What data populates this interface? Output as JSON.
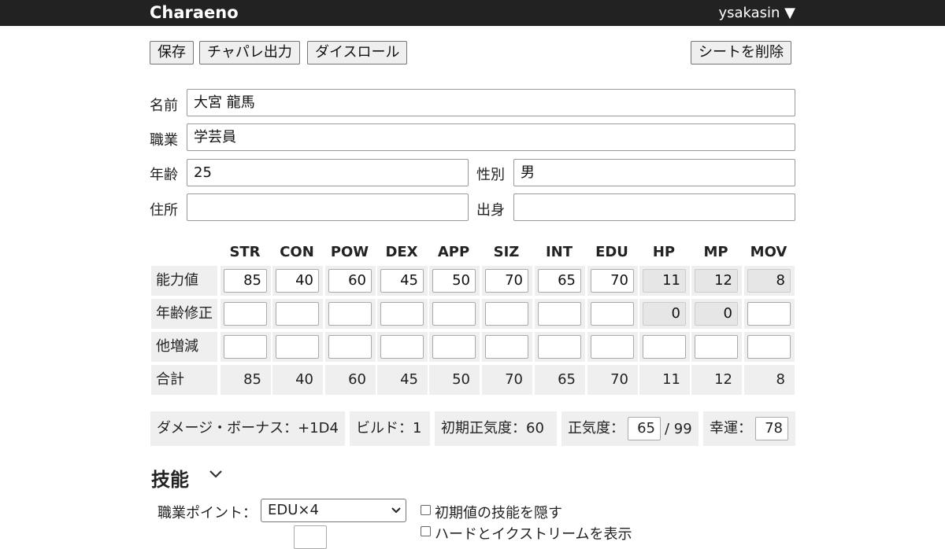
{
  "app": {
    "title": "Charaeno",
    "user": "ysakasin ▼"
  },
  "toolbar": {
    "save": "保存",
    "chapare": "チャパレ出力",
    "dice": "ダイスロール",
    "delete": "シートを削除"
  },
  "profile": {
    "name_label": "名前",
    "name_value": "大宮 龍馬",
    "job_label": "職業",
    "job_value": "学芸員",
    "age_label": "年齢",
    "age_value": "25",
    "gender_label": "性別",
    "gender_value": "男",
    "address_label": "住所",
    "address_value": "",
    "origin_label": "出身",
    "origin_value": ""
  },
  "stats": {
    "headers": [
      "STR",
      "CON",
      "POW",
      "DEX",
      "APP",
      "SIZ",
      "INT",
      "EDU",
      "HP",
      "MP",
      "MOV"
    ],
    "row_labels": [
      "能力値",
      "年齢修正",
      "他増減",
      "合計"
    ],
    "base": [
      "85",
      "40",
      "60",
      "45",
      "50",
      "70",
      "65",
      "70",
      "11",
      "12",
      "8"
    ],
    "age_mod": [
      "",
      "",
      "",
      "",
      "",
      "",
      "",
      "",
      "0",
      "0",
      ""
    ],
    "other": [
      "",
      "",
      "",
      "",
      "",
      "",
      "",
      "",
      "",
      "",
      ""
    ],
    "total": [
      "85",
      "40",
      "60",
      "45",
      "50",
      "70",
      "65",
      "70",
      "11",
      "12",
      "8"
    ]
  },
  "derived": {
    "damage_bonus": "ダメージ・ボーナス：+1D4",
    "build": "ビルド：1",
    "initial_san": "初期正気度：60",
    "san_label": "正気度：",
    "san_value": "65",
    "san_max": "/ 99",
    "luck_label": "幸運：",
    "luck_value": "78"
  },
  "skills": {
    "title": "技能",
    "job_points_label": "職業ポイント：",
    "job_points_value": "EDU×4",
    "hide_initial": "初期値の技能を隠す",
    "show_hard_extreme": "ハードとイクストリームを表示"
  }
}
